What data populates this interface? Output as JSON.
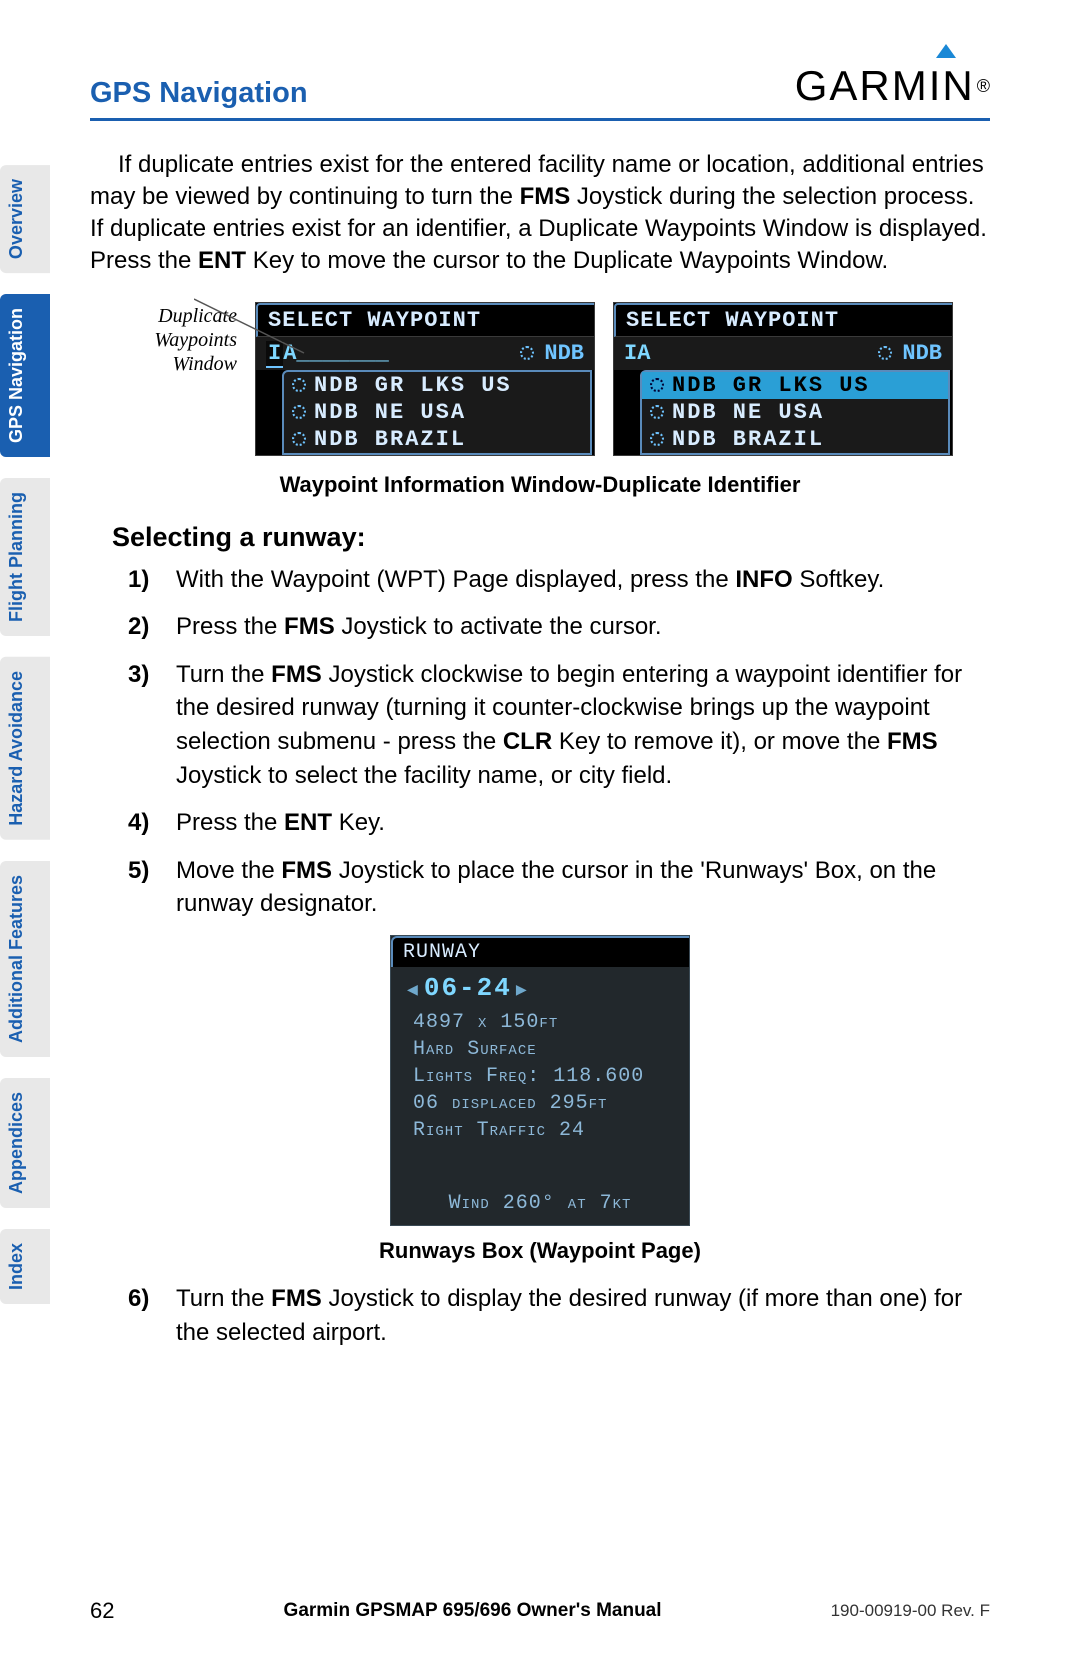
{
  "header": {
    "title": "GPS Navigation",
    "logo_text": "GARMIN"
  },
  "sidebar": {
    "tabs": [
      {
        "label": "Overview",
        "active": false
      },
      {
        "label": "GPS Navigation",
        "active": true
      },
      {
        "label": "Flight Planning",
        "active": false
      },
      {
        "label": "Hazard Avoidance",
        "active": false
      },
      {
        "label": "Additional Features",
        "active": false
      },
      {
        "label": "Appendices",
        "active": false
      },
      {
        "label": "Index",
        "active": false
      }
    ]
  },
  "intro": {
    "pre1": "If duplicate entries exist for the entered facility name or location, additional entries may be viewed by continuing to turn the ",
    "b1": "FMS",
    "mid1": " Joystick during the selection process.  If duplicate entries exist for an identifier, a Duplicate  Waypoints Window is displayed. Press the ",
    "b2": "ENT",
    "post1": " Key to move the cursor to the Duplicate Waypoints Window."
  },
  "callout": {
    "l1": "Duplicate",
    "l2": "Waypoints",
    "l3": "Window"
  },
  "wp": {
    "title": "SELECT WAYPOINT",
    "input_left": "IA",
    "input_right": "NDB",
    "items": [
      "NDB GR LKS US",
      "NDB NE USA",
      "NDB BRAZIL"
    ]
  },
  "caption1": "Waypoint Information Window-Duplicate Identifier",
  "subhead": "Selecting a runway:",
  "steps": {
    "s1_pre": "With the Waypoint (WPT) Page displayed, press the ",
    "s1_b": "INFO",
    "s1_post": " Softkey.",
    "s2_pre": "Press the ",
    "s2_b": "FMS",
    "s2_post": " Joystick to activate the cursor.",
    "s3_pre": "Turn the ",
    "s3_b1": "FMS",
    "s3_mid1": " Joystick clockwise to begin entering a waypoint identifier for the desired runway (turning it counter-clockwise brings up the waypoint selection submenu - press the ",
    "s3_b2": "CLR",
    "s3_mid2": " Key to remove it), or move the ",
    "s3_b3": "FMS",
    "s3_post": " Joystick to select the facility name, or city field.",
    "s4_pre": "Press the ",
    "s4_b": "ENT",
    "s4_post": " Key.",
    "s5_pre": "Move the ",
    "s5_b": "FMS",
    "s5_post": " Joystick to place the cursor in the 'Runways' Box, on the runway designator.",
    "s6_pre": "Turn the ",
    "s6_b": "FMS",
    "s6_post": " Joystick to display the desired runway (if more than one) for the selected airport."
  },
  "nums": {
    "n1": "1)",
    "n2": "2)",
    "n3": "3)",
    "n4": "4)",
    "n5": "5)",
    "n6": "6)"
  },
  "runway": {
    "title": "RUNWAY",
    "sel": "06-24",
    "dim": "4897 x 150ft",
    "surface": "Hard Surface",
    "lights": "Lights Freq: 118.600",
    "displaced": "06 displaced 295ft",
    "traffic": "Right Traffic  24",
    "wind": "Wind 260° at 7kt"
  },
  "caption2": "Runways Box (Waypoint Page)",
  "footer": {
    "page": "62",
    "manual": "Garmin GPSMAP 695/696 Owner's Manual",
    "rev": "190-00919-00  Rev. F"
  }
}
